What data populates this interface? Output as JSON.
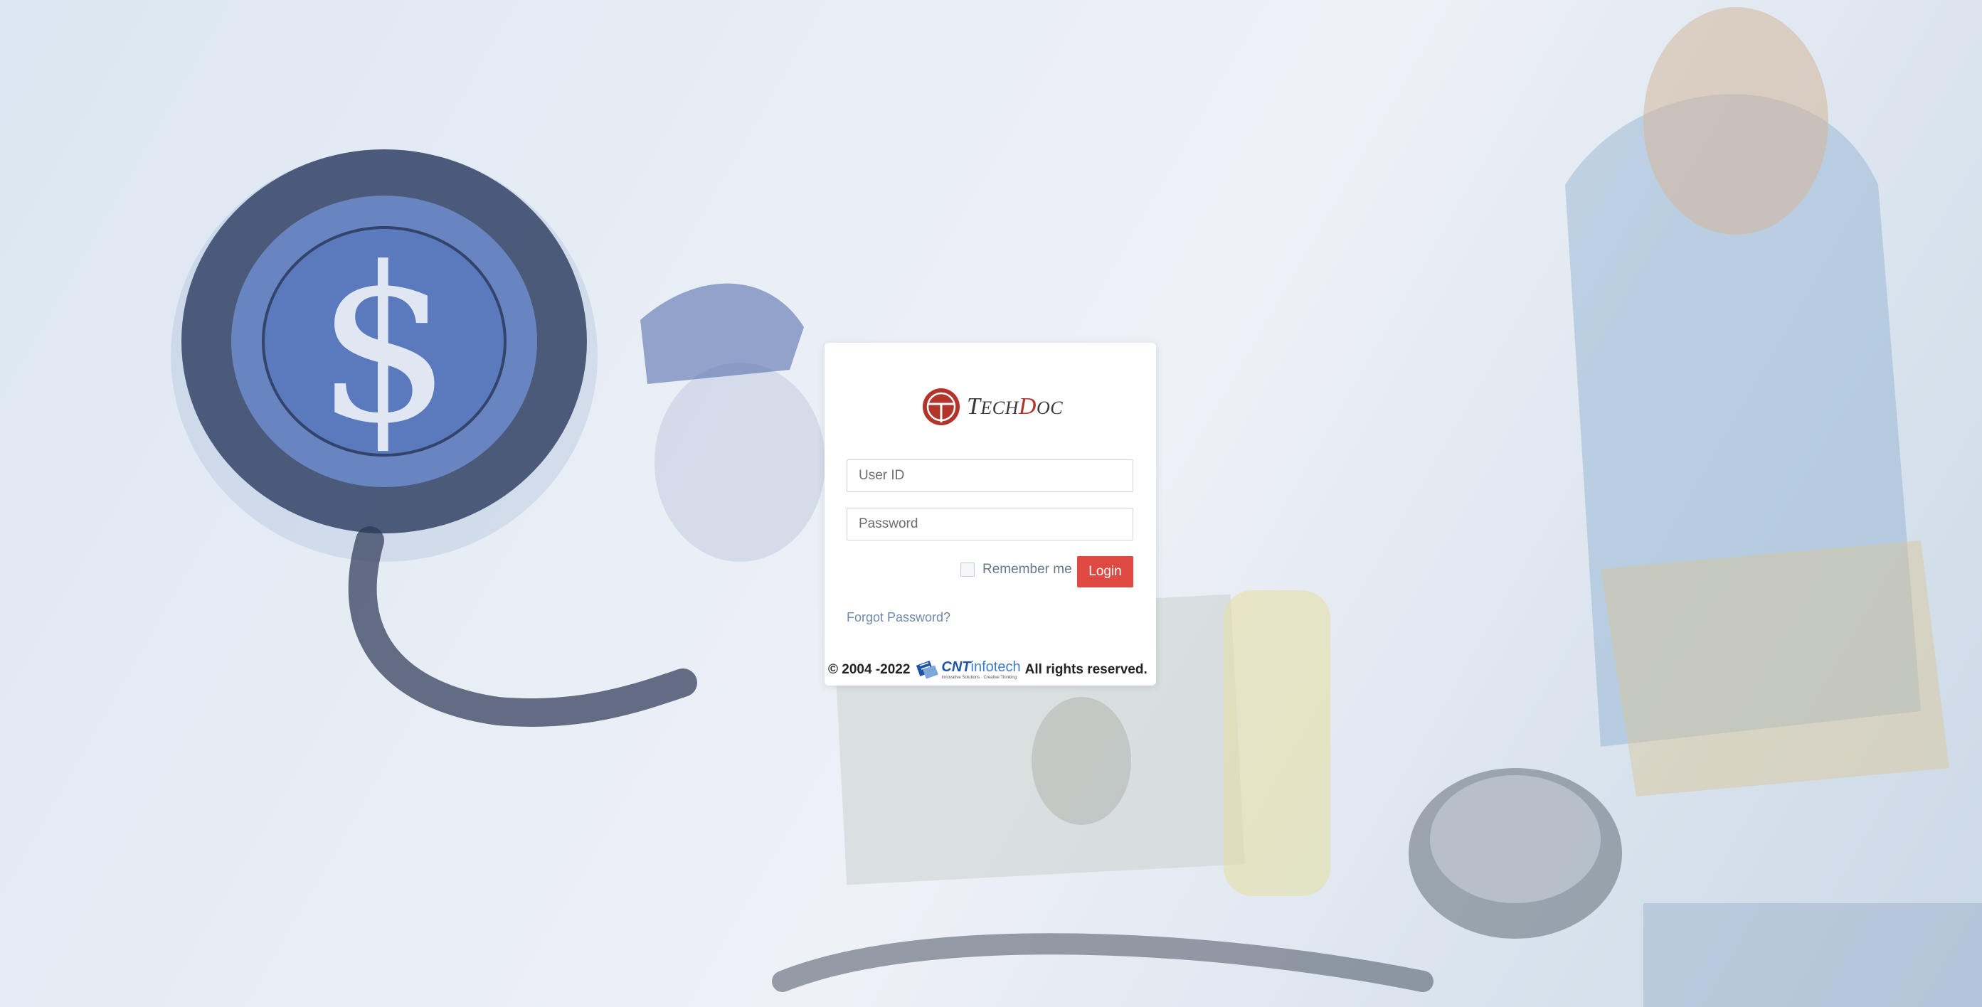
{
  "background": {
    "description_icon": "medical-background-image",
    "dollar_symbol": "$"
  },
  "logo": {
    "text_prefix": "T",
    "text_mid": "ECH",
    "text_accent": "D",
    "text_suffix": "OC"
  },
  "form": {
    "userid_placeholder": "User ID",
    "password_placeholder": "Password",
    "remember_label": "Remember me",
    "login_label": "Login",
    "forgot_label": "Forgot Password?"
  },
  "footer": {
    "copyright": "© 2004 -2022",
    "company_bold": "CNT",
    "company_light": "infotech",
    "company_tagline": "Innovative Solutions · Creative Thinking",
    "rights": "All rights reserved."
  },
  "colors": {
    "accent": "#de4a41",
    "link": "#6f89a8",
    "logo_red": "#b3342b",
    "brand_blue": "#1f55a8"
  }
}
